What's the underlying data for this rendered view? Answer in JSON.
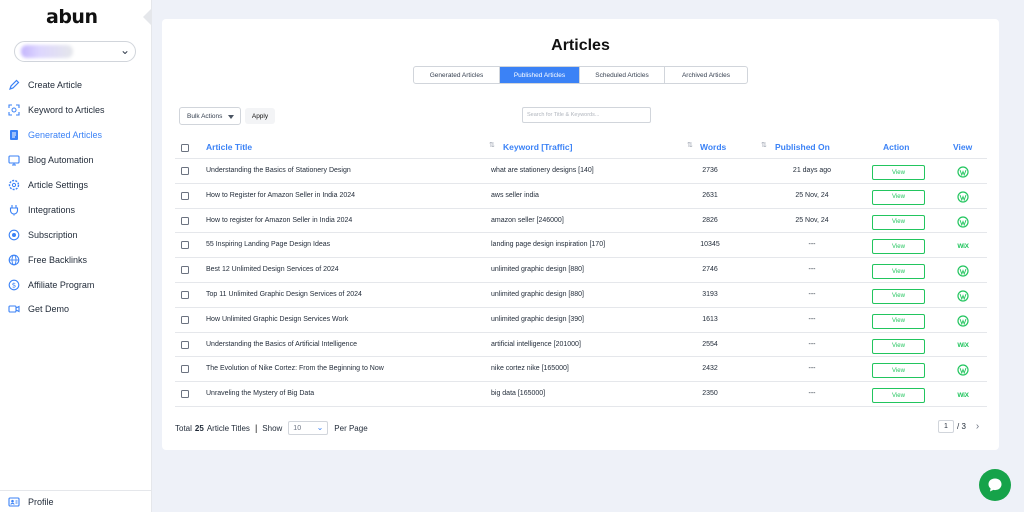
{
  "sidebar": {
    "logo": "abun",
    "items": [
      {
        "label": "Create Article",
        "icon": "pen-icon"
      },
      {
        "label": "Keyword to Articles",
        "icon": "scan-icon"
      },
      {
        "label": "Generated Articles",
        "icon": "document-icon",
        "active": true
      },
      {
        "label": "Blog Automation",
        "icon": "monitor-icon"
      },
      {
        "label": "Article Settings",
        "icon": "gear-icon"
      },
      {
        "label": "Integrations",
        "icon": "plug-icon"
      },
      {
        "label": "Subscription",
        "icon": "subscription-icon"
      },
      {
        "label": "Free Backlinks",
        "icon": "globe-icon"
      },
      {
        "label": "Affiliate Program",
        "icon": "dollar-icon"
      },
      {
        "label": "Get Demo",
        "icon": "video-icon"
      }
    ],
    "profile_label": "Profile"
  },
  "main": {
    "title": "Articles",
    "tabs": [
      {
        "label": "Generated Articles"
      },
      {
        "label": "Published Articles",
        "active": true
      },
      {
        "label": "Scheduled Articles"
      },
      {
        "label": "Archived Articles"
      }
    ],
    "bulk_actions_label": "Bulk Actions",
    "apply_label": "Apply",
    "search_placeholder": "Search for Title & Keywords...",
    "columns": {
      "title": "Article Title",
      "keyword": "Keyword [Traffic]",
      "words": "Words",
      "published": "Published On",
      "action": "Action",
      "view": "View"
    },
    "view_button_label": "View",
    "rows": [
      {
        "title": "Understanding the Basics of Stationery Design",
        "keyword": "what are stationery designs [140]",
        "words": "2736",
        "published": "21 days ago",
        "platform": "wordpress"
      },
      {
        "title": "How to Register for Amazon Seller in India 2024",
        "keyword": "aws seller india",
        "words": "2631",
        "published": "25 Nov, 24",
        "platform": "wordpress"
      },
      {
        "title": "How to register for Amazon Seller in India 2024",
        "keyword": "amazon seller [246000]",
        "words": "2826",
        "published": "25 Nov, 24",
        "platform": "wordpress"
      },
      {
        "title": "55 Inspiring Landing Page Design Ideas",
        "keyword": "landing page design inspiration [170]",
        "words": "10345",
        "published": "---",
        "platform": "wix"
      },
      {
        "title": "Best 12 Unlimited Design Services of 2024",
        "keyword": "unlimited graphic design [880]",
        "words": "2746",
        "published": "---",
        "platform": "wordpress"
      },
      {
        "title": "Top 11 Unlimited Graphic Design Services of 2024",
        "keyword": "unlimited graphic design [880]",
        "words": "3193",
        "published": "---",
        "platform": "wordpress"
      },
      {
        "title": "How Unlimited Graphic Design Services Work",
        "keyword": "unlimited graphic design [390]",
        "words": "1613",
        "published": "---",
        "platform": "wordpress"
      },
      {
        "title": "Understanding the Basics of Artificial Intelligence",
        "keyword": "artificial intelligence [201000]",
        "words": "2554",
        "published": "---",
        "platform": "wix"
      },
      {
        "title": "The Evolution of Nike Cortez: From the Beginning to Now",
        "keyword": "nike cortez nike [165000]",
        "words": "2432",
        "published": "---",
        "platform": "wordpress"
      },
      {
        "title": "Unraveling the Mystery of Big Data",
        "keyword": "big data [165000]",
        "words": "2350",
        "published": "---",
        "platform": "wix"
      }
    ],
    "wix_label": "WiX",
    "footer": {
      "total_prefix": "Total",
      "total_count": "25",
      "total_suffix": "Article Titles",
      "separator": "|",
      "show_label": "Show",
      "per_page_value": "10",
      "per_page_label": "Per Page",
      "current_page": "1",
      "page_total": "/ 3"
    }
  },
  "colors": {
    "accent": "#3b82f6",
    "success": "#22c55e",
    "chat": "#16a34a"
  }
}
